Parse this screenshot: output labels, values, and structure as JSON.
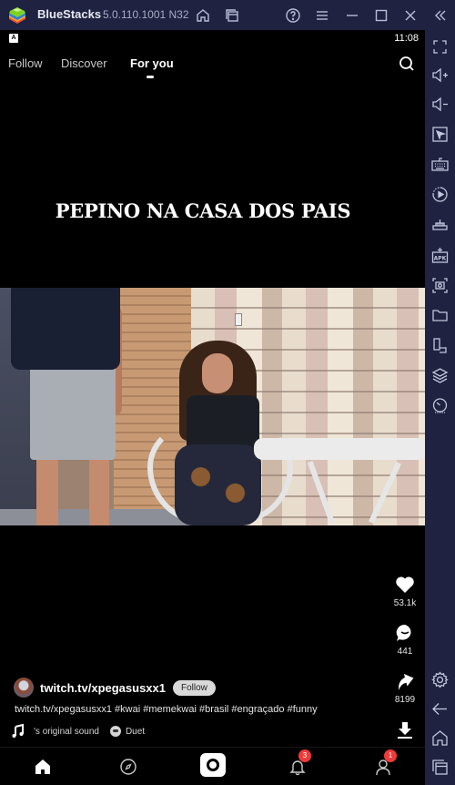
{
  "window": {
    "app_name": "BlueStacks",
    "version": "5.0.110.1001 N32",
    "title_icons": [
      "home-icon",
      "multi-instance-icon",
      "help-icon",
      "menu-icon",
      "minimize-icon",
      "maximize-icon",
      "close-icon",
      "collapse-sidebar-icon"
    ]
  },
  "statusbar": {
    "indicator": "A",
    "time": "11:08"
  },
  "topnav": {
    "tabs": [
      {
        "label": "Follow",
        "active": false
      },
      {
        "label": "Discover",
        "active": false
      },
      {
        "label": "For you",
        "active": true
      }
    ],
    "search_icon": "search-icon"
  },
  "video": {
    "caption": "PEPINO NA CASA DOS PAIS"
  },
  "actions": {
    "like": {
      "icon": "heart-icon",
      "count": "53.1k"
    },
    "comment": {
      "icon": "comment-icon",
      "count": "441"
    },
    "share": {
      "icon": "share-icon",
      "count": "8199"
    },
    "download": {
      "icon": "download-icon"
    }
  },
  "post": {
    "author": "twitch.tv/xpegasusxx1",
    "follow_label": "Follow",
    "description": "twitch.tv/xpegasusxx1 #kwai #memekwai #brasil #engraçado #funny",
    "sound": "'s original sound",
    "duet_label": "Duet"
  },
  "bottomnav": {
    "items": [
      {
        "name": "home",
        "icon": "home-icon",
        "active": true
      },
      {
        "name": "discover",
        "icon": "compass-icon"
      },
      {
        "name": "record",
        "icon": "camera-record-icon"
      },
      {
        "name": "notifications",
        "icon": "bell-icon",
        "badge": "3"
      },
      {
        "name": "profile",
        "icon": "profile-icon",
        "badge": "1"
      }
    ]
  },
  "sidebar": {
    "items": [
      "fullscreen-icon",
      "volume-up-icon",
      "volume-down-icon",
      "pointer-icon",
      "keyboard-icon",
      "record-macro-icon",
      "gamepad-icon",
      "install-apk-icon",
      "screenshot-icon",
      "folder-icon",
      "rotate-icon",
      "layers-icon",
      "performance-icon",
      "settings-icon",
      "back-icon",
      "home-icon",
      "recent-apps-icon"
    ]
  },
  "colors": {
    "chrome_bg": "#1f2240",
    "screen_bg": "#000000",
    "badge_red": "#f03a3a"
  }
}
